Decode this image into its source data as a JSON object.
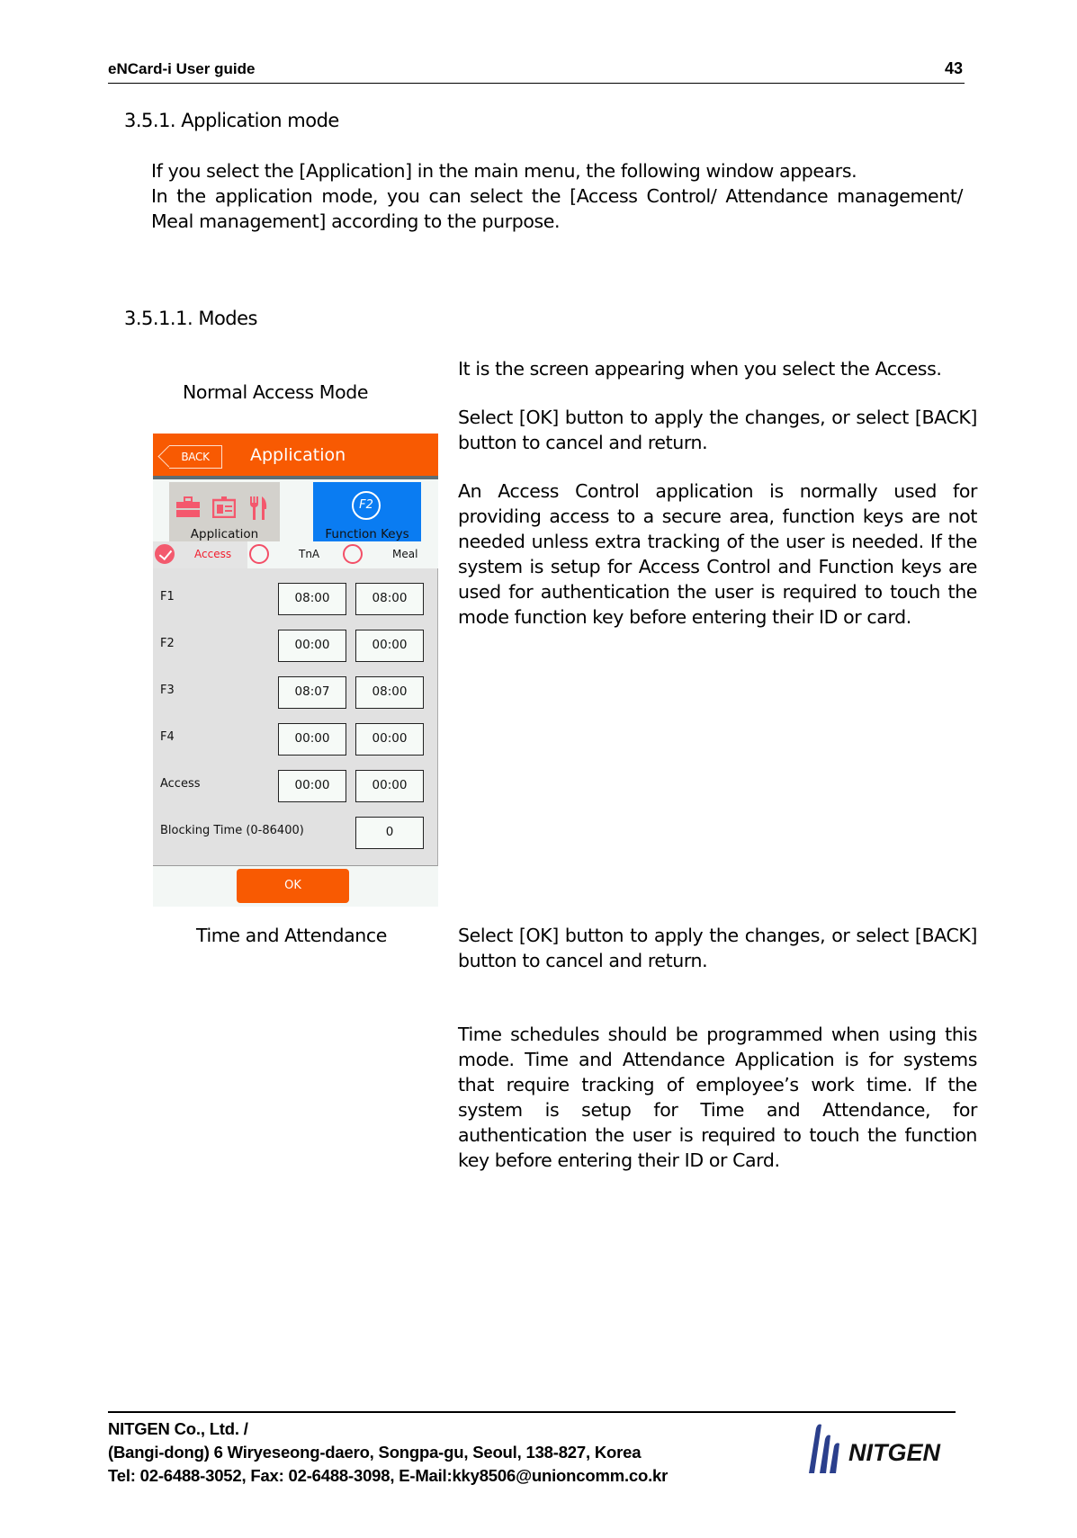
{
  "header": {
    "title": "eNCard-i User guide",
    "page_number": "43"
  },
  "section": {
    "heading": "3.5.1. Application mode",
    "intro": [
      "If you select the [Application] in the main menu, the following window appears.",
      "In the application mode, you can select the [Access Control/ Attendance management/ Meal management] according to the purpose."
    ],
    "subheading": "3.5.1.1. Modes"
  },
  "modes": [
    {
      "label": "Normal Access Mode",
      "paragraphs": [
        "It is the screen appearing when you select the Access.",
        "Select [OK] button to apply the changes, or select [BACK] button to cancel and return.",
        "An Access Control application is normally used for providing access to a secure area, function keys are not needed unless extra tracking of the user is needed. If the system is setup for Access Control and Function keys are used for authentication the user is required to touch the mode function key before entering their ID or card."
      ]
    },
    {
      "label": "Time and Attendance",
      "paragraphs": [
        "Select [OK] button to apply the changes, or select [BACK] button to cancel and return.",
        "Time schedules should be programmed when using this mode. Time and Attendance Application is for systems that require tracking of employee’s work time. If the system is setup for Time and Attendance, for authentication the user is required to touch the function key before entering their ID or Card."
      ]
    }
  ],
  "device_screen": {
    "back_label": "BACK",
    "title": "Application",
    "tiles": [
      {
        "label": "Application",
        "icons": [
          "briefcase-icon",
          "id-card-icon",
          "fork-knife-icon"
        ]
      },
      {
        "label": "Function Keys",
        "icon_text": "F2"
      }
    ],
    "modes": [
      {
        "label": "Access",
        "selected": true
      },
      {
        "label": "TnA",
        "selected": false
      },
      {
        "label": "Meal",
        "selected": false
      }
    ],
    "rows": [
      {
        "label": "F1",
        "start": "08:00",
        "end": "08:00"
      },
      {
        "label": "F2",
        "start": "00:00",
        "end": "00:00"
      },
      {
        "label": "F3",
        "start": "08:07",
        "end": "08:00"
      },
      {
        "label": "F4",
        "start": "00:00",
        "end": "00:00"
      },
      {
        "label": "Access",
        "start": "00:00",
        "end": "00:00"
      }
    ],
    "blocking_time": {
      "label": "Blocking Time (0-86400)",
      "value": "0"
    },
    "ok_label": "OK",
    "colors": {
      "accent": "#f85a02",
      "function_tile": "#0a7cf2",
      "radio": "#f35a6e"
    }
  },
  "footer": {
    "company": "NITGEN Co., Ltd. /",
    "address": "(Bangi-dong) 6 Wiryeseong-daero, Songpa-gu, Seoul, 138-827, Korea",
    "contact": "Tel: 02-6488-3052, Fax: 02-6488-3098, E-Mail:kky8506@unioncomm.co.kr",
    "logo_text": "NITGEN",
    "logo_color": "#2b3f8c"
  }
}
